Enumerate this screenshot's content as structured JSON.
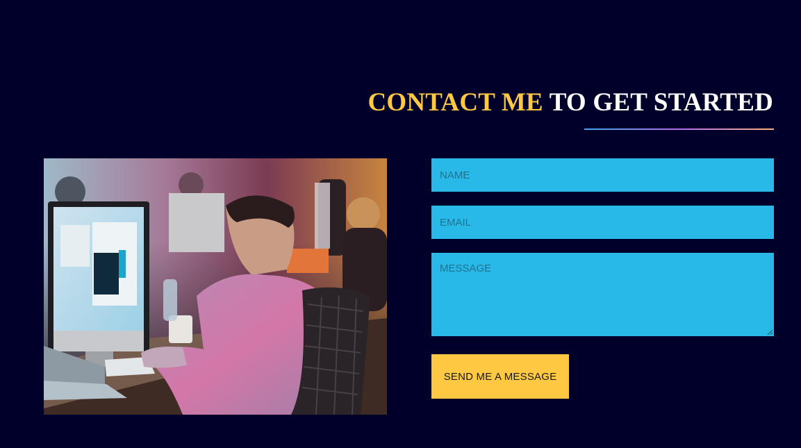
{
  "section": {
    "heading_accent": "CONTACT ME",
    "heading_rest": " TO GET STARTED"
  },
  "form": {
    "name_placeholder": "NAME",
    "email_placeholder": "EMAIL",
    "message_placeholder": "MESSAGE",
    "submit_label": "SEND ME A MESSAGE"
  },
  "colors": {
    "background": "#00002a",
    "accent": "#fec843",
    "field_background": "#29b9e8",
    "heading_text": "#ffffff"
  }
}
